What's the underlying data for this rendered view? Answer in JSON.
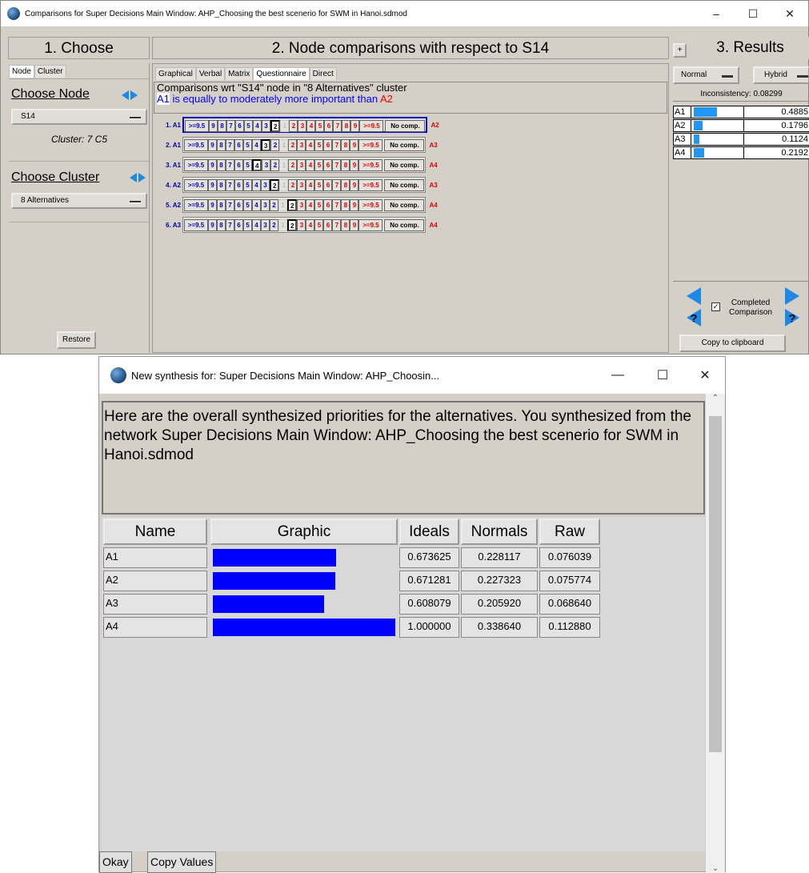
{
  "main_window": {
    "title": "Comparisons for Super Decisions Main Window: AHP_Choosing the best scenerio for SWM in Hanoi.sdmod",
    "controls": {
      "minimize": "–",
      "maximize": "☐",
      "close": "✕"
    },
    "choose": {
      "heading": "1. Choose",
      "tabs": [
        "Node",
        "Cluster"
      ],
      "choose_node_label": "Choose Node",
      "node_value": "S14",
      "cluster_info": "Cluster: 7 C5",
      "choose_cluster_label": "Choose Cluster",
      "cluster_value": "8 Alternatives",
      "restore_label": "Restore"
    },
    "compare": {
      "heading": "2. Node comparisons with respect to S14",
      "tabs": [
        "Graphical",
        "Verbal",
        "Matrix",
        "Questionnaire",
        "Direct"
      ],
      "active_tab": "Questionnaire",
      "desc_line1": "Comparisons wrt \"S14\" node in \"8 Alternatives\" cluster",
      "desc_left": "A1",
      "desc_mid": "is equally to moderately more important than",
      "desc_right": "A2",
      "scale_left": [
        ">=9.5",
        "9",
        "8",
        "7",
        "6",
        "5",
        "4",
        "3",
        "2"
      ],
      "scale_mid": "1",
      "scale_right": [
        "2",
        "3",
        "4",
        "5",
        "6",
        "7",
        "8",
        "9",
        ">=9.5"
      ],
      "no_comp": "No comp.",
      "rows": [
        {
          "num": "1.",
          "left": "A1",
          "right": "A2",
          "selected": "L2"
        },
        {
          "num": "2.",
          "left": "A1",
          "right": "A3",
          "selected": "L3"
        },
        {
          "num": "3.",
          "left": "A1",
          "right": "A4",
          "selected": "L4"
        },
        {
          "num": "4.",
          "left": "A2",
          "right": "A3",
          "selected": "L2"
        },
        {
          "num": "5.",
          "left": "A2",
          "right": "A4",
          "selected": "R2"
        },
        {
          "num": "6.",
          "left": "A3",
          "right": "A4",
          "selected": "R2"
        }
      ]
    },
    "results": {
      "plus": "+",
      "heading": "3. Results",
      "mode": "Normal",
      "type": "Hybrid",
      "inconsistency": "Inconsistency: 0.08299",
      "rows": [
        {
          "name": "A1",
          "value": "0.4885",
          "level": 0.4885
        },
        {
          "name": "A2",
          "value": "0.1796",
          "level": 0.1796
        },
        {
          "name": "A3",
          "value": "0.1124",
          "level": 0.1124
        },
        {
          "name": "A4",
          "value": "0.2192",
          "level": 0.2192
        }
      ],
      "completed_label": "Completed Comparison",
      "copy_label": "Copy to clipboard"
    }
  },
  "synthesis_window": {
    "title": "New synthesis for: Super Decisions Main Window: AHP_Choosin...",
    "controls": {
      "minimize": "—",
      "maximize": "☐",
      "close": "✕"
    },
    "message": "Here are the overall synthesized priorities for the alternatives. You synthesized from the network Super Decisions Main Window: AHP_Choosing the best scenerio for SWM in Hanoi.sdmod",
    "columns": [
      "Name",
      "Graphic",
      "Ideals",
      "Normals",
      "Raw"
    ],
    "rows": [
      {
        "name": "A1",
        "ideal": "0.673625",
        "normal": "0.228117",
        "raw": "0.076039",
        "level": 0.673625
      },
      {
        "name": "A2",
        "ideal": "0.671281",
        "normal": "0.227323",
        "raw": "0.075774",
        "level": 0.671281
      },
      {
        "name": "A3",
        "ideal": "0.608079",
        "normal": "0.205920",
        "raw": "0.068640",
        "level": 0.608079
      },
      {
        "name": "A4",
        "ideal": "1.000000",
        "normal": "0.338640",
        "raw": "0.112880",
        "level": 1.0
      }
    ],
    "okay_label": "Okay",
    "copy_values_label": "Copy Values"
  },
  "colors": {
    "scale_left": "#0000c8",
    "scale_right": "#dd0000",
    "result_bar": "#2196f3",
    "graphic_bar": "#0000ff"
  }
}
